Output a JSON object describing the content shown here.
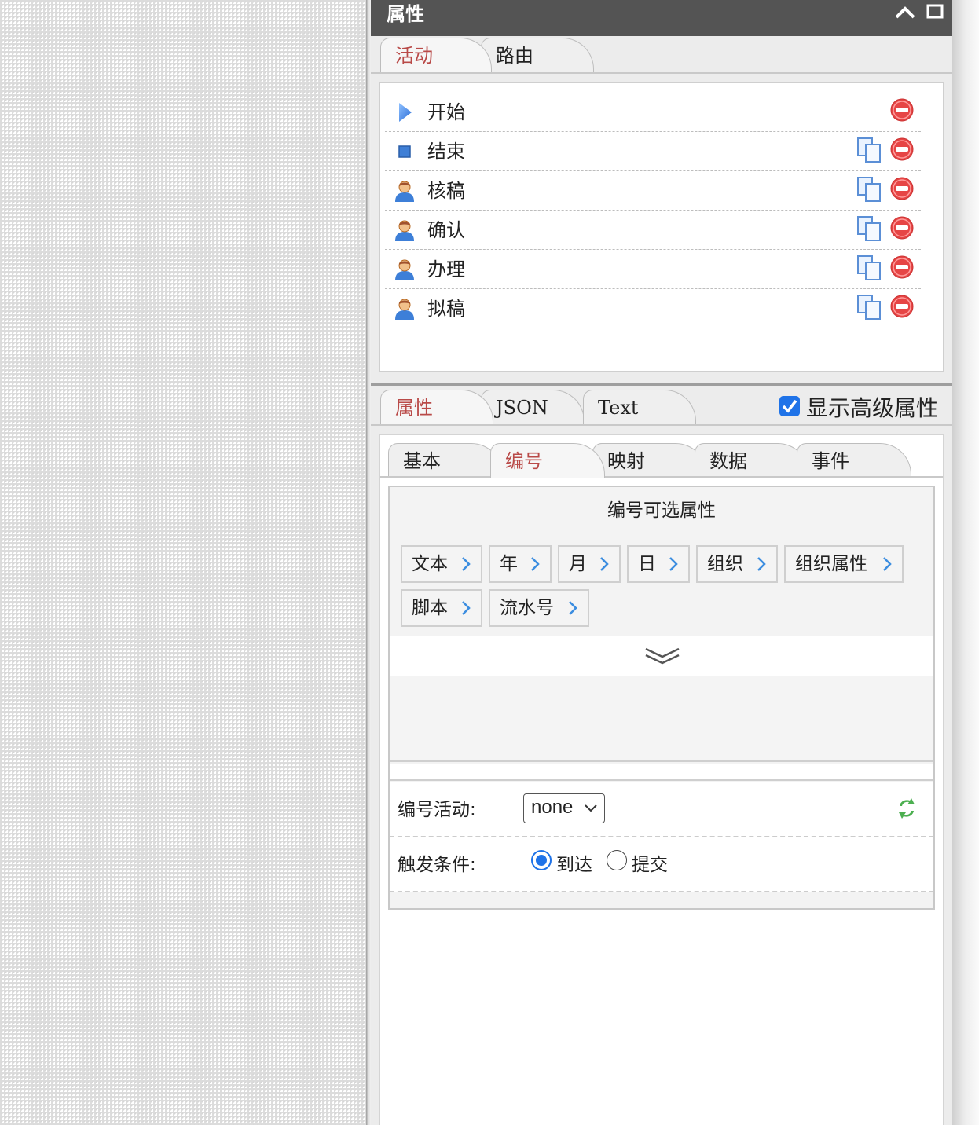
{
  "panel": {
    "title": "属性"
  },
  "top_tabs": [
    {
      "label": "活动",
      "active": true
    },
    {
      "label": "路由",
      "active": false
    }
  ],
  "activities": [
    {
      "label": "开始",
      "icon": "play-icon",
      "copy": false
    },
    {
      "label": "结束",
      "icon": "stop-icon",
      "copy": true
    },
    {
      "label": "核稿",
      "icon": "user-icon",
      "copy": true
    },
    {
      "label": "确认",
      "icon": "user-icon",
      "copy": true
    },
    {
      "label": "办理",
      "icon": "user-icon",
      "copy": true
    },
    {
      "label": "拟稿",
      "icon": "user-icon",
      "copy": true
    }
  ],
  "prop_tabs": [
    {
      "label": "属性",
      "active": true
    },
    {
      "label": "JSON",
      "active": false
    },
    {
      "label": "Text",
      "active": false
    }
  ],
  "advanced": {
    "label": "显示高级属性",
    "checked": true
  },
  "sub_tabs": [
    {
      "label": "基本",
      "active": false
    },
    {
      "label": "编号",
      "active": true
    },
    {
      "label": "映射",
      "active": false
    },
    {
      "label": "数据",
      "active": false
    },
    {
      "label": "事件",
      "active": false
    }
  ],
  "numbering": {
    "title": "编号可选属性",
    "chips_row1": [
      "文本",
      "年",
      "月",
      "日",
      "组织",
      "组织属性"
    ],
    "chips_row2": [
      "脚本",
      "流水号"
    ]
  },
  "form": {
    "activity_label": "编号活动:",
    "activity_value": "none",
    "trigger_label": "触发条件:",
    "trigger_options": [
      "到达",
      "提交"
    ],
    "trigger_selected": "到达"
  },
  "colors": {
    "header_bg": "#545454",
    "active_tab_text": "#b94a48",
    "accent_blue": "#1f73e8",
    "remove_red": "#e64545"
  }
}
